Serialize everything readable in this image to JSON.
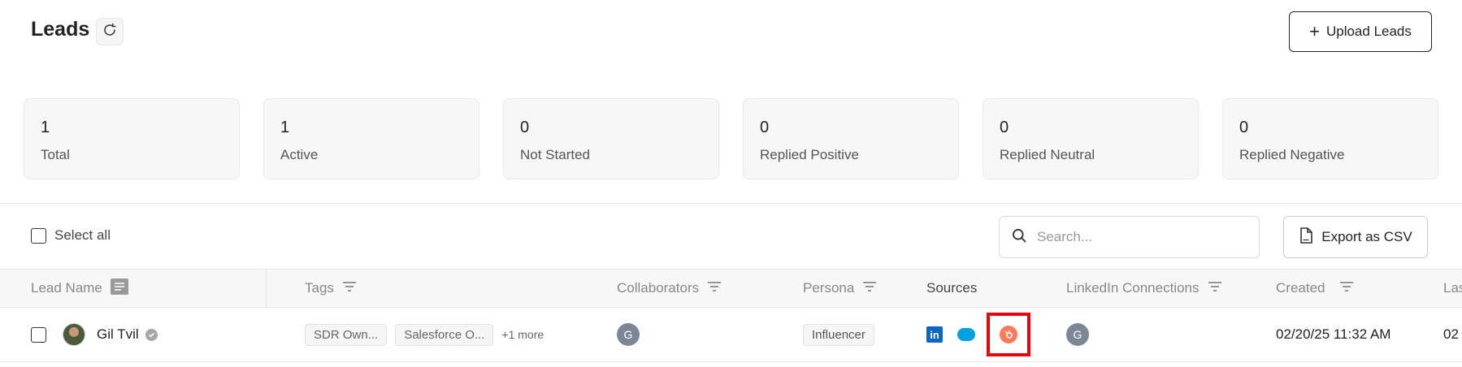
{
  "header": {
    "title": "Leads",
    "refresh_icon": "refresh-icon",
    "upload_label": "Upload Leads",
    "upload_icon": "plus-icon"
  },
  "stats": [
    {
      "value": "1",
      "label": "Total"
    },
    {
      "value": "1",
      "label": "Active"
    },
    {
      "value": "0",
      "label": "Not Started"
    },
    {
      "value": "0",
      "label": "Replied Positive"
    },
    {
      "value": "0",
      "label": "Replied Neutral"
    },
    {
      "value": "0",
      "label": "Replied Negative"
    }
  ],
  "toolbar": {
    "select_all_label": "Select all",
    "search_placeholder": "Search...",
    "export_label": "Export as CSV"
  },
  "table": {
    "columns": [
      "Lead Name",
      "Tags",
      "Collaborators",
      "Persona",
      "Sources",
      "LinkedIn Connections",
      "Created",
      "Las"
    ],
    "rows": [
      {
        "lead_name": "Gil Tvil",
        "tags": [
          "SDR Own...",
          "Salesforce O..."
        ],
        "more_tags": "+1 more",
        "collaborator_initial": "G",
        "persona": "Influencer",
        "sources": [
          "linkedin-icon",
          "salesforce-icon",
          "hubspot-icon"
        ],
        "linkedin_initial": "G",
        "created": "02/20/25 11:32 AM",
        "last_partial": "02"
      }
    ]
  },
  "colors": {
    "linkedin": "#0a66c2",
    "salesforce": "#00a1e0",
    "hubspot": "#ff7a59",
    "highlight": "#e8000b"
  }
}
